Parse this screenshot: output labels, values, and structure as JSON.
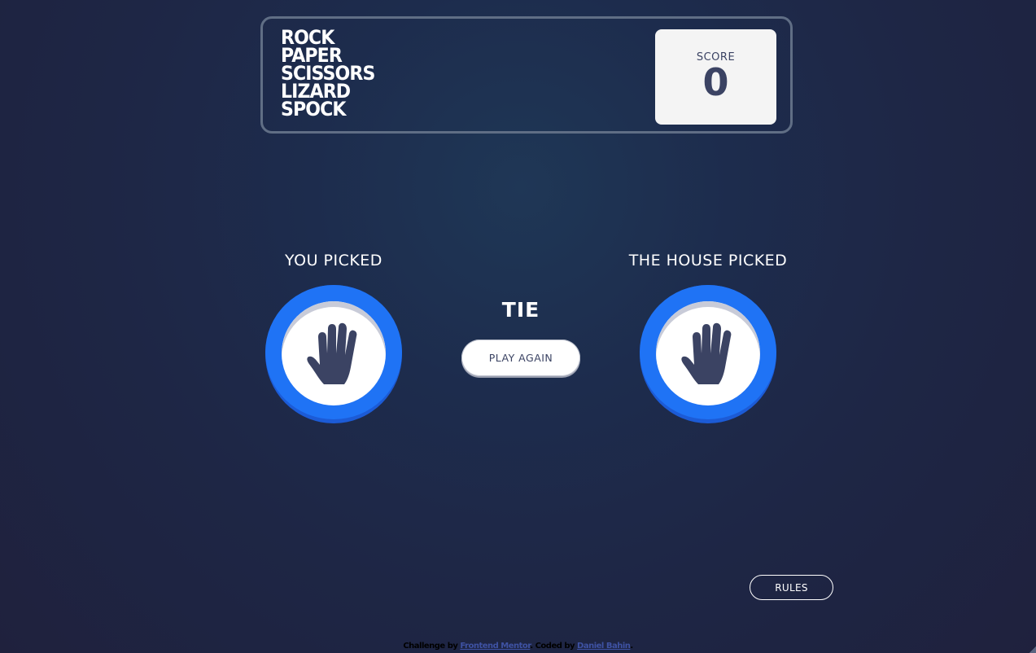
{
  "header": {
    "logo_lines": [
      "ROCK",
      "PAPER",
      "SCISSORS",
      "LIZARD",
      "SPOCK"
    ],
    "score_label": "SCORE",
    "score_value": "0"
  },
  "game": {
    "you_label": "YOU PICKED",
    "house_label": "THE HOUSE PICKED",
    "you_pick": "paper-icon",
    "house_pick": "paper-icon",
    "result": "TIE",
    "play_again_label": "PLAY AGAIN"
  },
  "rules_label": "RULES",
  "attribution": {
    "prefix": "Challenge by ",
    "link1": "Frontend Mentor",
    "middle": ". Coded by ",
    "link2": "Daniel Bahin",
    "suffix": "."
  },
  "colors": {
    "paper_ring": "#1f73f5",
    "background": "#1f2a48",
    "score_text": "#3b4363"
  }
}
